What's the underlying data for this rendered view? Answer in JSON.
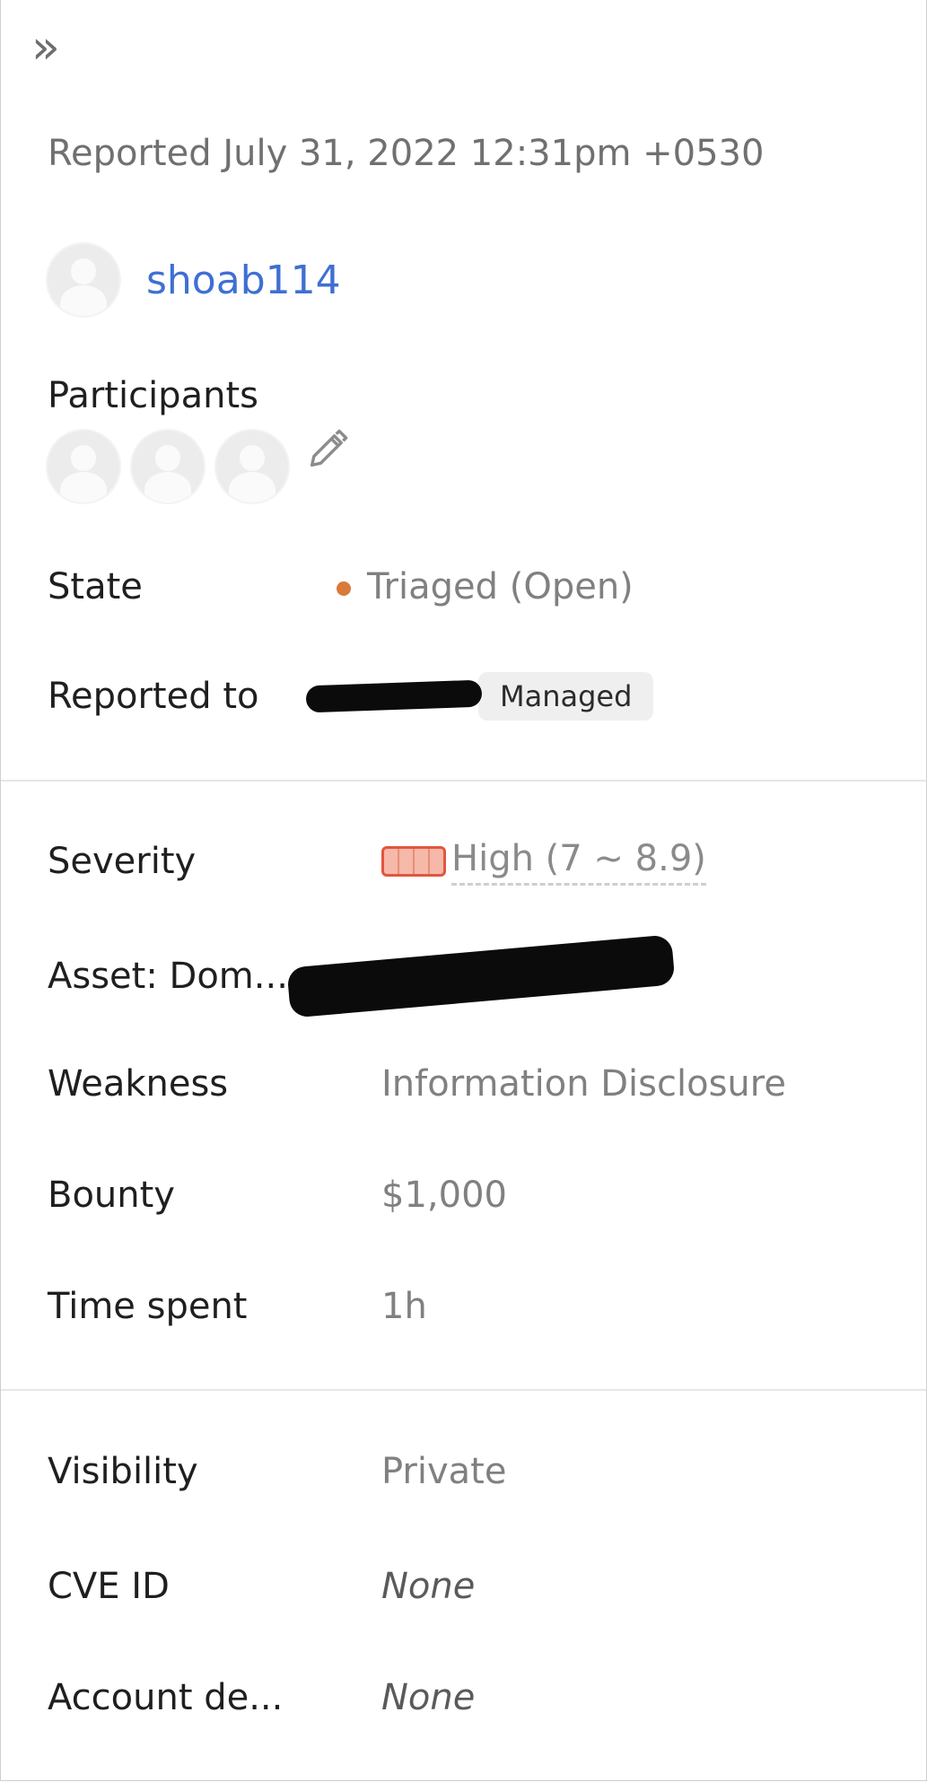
{
  "header": {
    "collapse_icon": "double-chevron-right-icon",
    "collapse_glyph": "»"
  },
  "report": {
    "reported_text": "Reported July 31, 2022 12:31pm +0530",
    "reporter": "shoab114"
  },
  "participants": {
    "label": "Participants",
    "count": 3
  },
  "fields": {
    "state": {
      "label": "State",
      "value": "Triaged (Open)",
      "dot_color": "#d97a3a"
    },
    "reported_to": {
      "label": "Reported to",
      "badge": "Managed"
    },
    "severity": {
      "label": "Severity",
      "value": "High (7 ~ 8.9)",
      "color": "#e0573e"
    },
    "asset": {
      "label": "Asset: Dom..."
    },
    "weakness": {
      "label": "Weakness",
      "value": "Information Disclosure"
    },
    "bounty": {
      "label": "Bounty",
      "value": "$1,000"
    },
    "time_spent": {
      "label": "Time spent",
      "value": "1h"
    },
    "visibility": {
      "label": "Visibility",
      "value": "Private"
    },
    "cve_id": {
      "label": "CVE ID",
      "value": "None"
    },
    "account_details": {
      "label": "Account de...",
      "value": "None"
    }
  },
  "colors": {
    "link": "#3f6fd3",
    "label_text": "#1f1f1f",
    "value_text": "#808080"
  }
}
